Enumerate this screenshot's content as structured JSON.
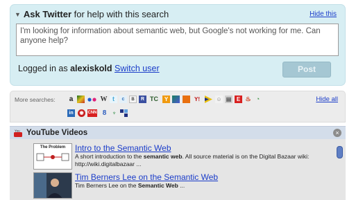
{
  "ask": {
    "title_bold": "Ask Twitter",
    "title_rest": " for help with this search",
    "hide_label": "Hide this",
    "message": "I'm looking for information about semantic web, but Google's not working for me. Can anyone help?",
    "logged_prefix": "Logged in as ",
    "username": "alexiskold",
    "switch_user": "Switch user",
    "post_label": "Post"
  },
  "more_searches": {
    "label": "More searches:",
    "hide_all": "Hide all",
    "icons": [
      "amazon-icon",
      "flickr-icon",
      "yelp-icon",
      "wikipedia-icon",
      "twitter-icon",
      "delicious-icon",
      "digg-icon",
      "techcrunch-icon",
      "yahoo-answers-icon",
      "stumbleupon-icon",
      "yahoo-icon",
      "youtube-icon",
      "picasa-icon",
      "engadget-icon",
      "reddit-icon",
      "google-icon",
      "linkedin-icon",
      "mashable-icon",
      "cnn-icon",
      "google-search-icon",
      "wordpress-icon",
      "delicious2-icon"
    ]
  },
  "youtube": {
    "title": "YouTube Videos",
    "close": "×",
    "results": [
      {
        "thumb_title": "The Problem",
        "title": "Intro to the Semantic Web",
        "desc_pre": "A short introduction to the ",
        "desc_bold": "semantic web",
        "desc_post": ". All source material is on the Digital Bazaar wiki: http://wiki.digitalbazaar ..."
      },
      {
        "title": "Tim Berners Lee on the Semantic Web",
        "desc_pre": "Tim Berners Lee on the ",
        "desc_bold": "Semantic Web",
        "desc_post": " ..."
      }
    ]
  }
}
